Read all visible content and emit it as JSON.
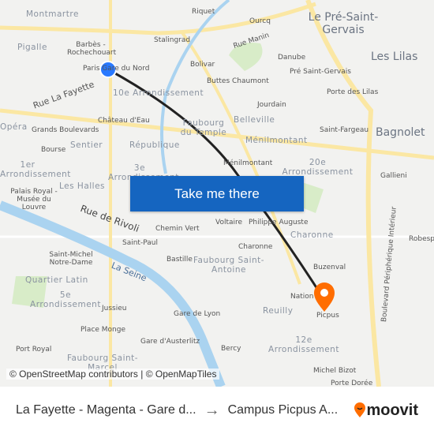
{
  "map": {
    "labels": [
      "Montmartre",
      "Pigalle",
      "Barbès - Rochechouart",
      "Paris Gare du Nord",
      "Stalingrad",
      "Riquet",
      "Ourcq",
      "Rue Manin",
      "Bolivar",
      "Buttes Chaumont",
      "Danube",
      "Pré Saint-Gervais",
      "Porte des Lilas",
      "Jourdain",
      "Belleville",
      "Ménilmontant",
      "Saint-Fargeau",
      "Rue La Fayette",
      "Château d'Eau",
      "Opéra",
      "Grands Boulevards",
      "Bourse",
      "Sentier",
      "République",
      "Ménilmontant",
      "Gallieni",
      "Palais Royal - Musée du Louvre",
      "Rue de Rivoli",
      "Chemin Vert",
      "Voltaire",
      "Philippe Auguste",
      "Saint-Paul",
      "Bastille",
      "Charonne",
      "Buzenval",
      "Saint-Michel Notre-Dame",
      "La Seine",
      "Jussieu",
      "Nation",
      "Picpus",
      "Reuilly",
      "Place Monge",
      "Gare de Lyon",
      "Gare d'Austerlitz",
      "Port Royal",
      "Bercy",
      "Michel Bizot",
      "Porte Dorée",
      "Boulevard Périphérique Intérieur",
      "Robespierre"
    ],
    "districts": [
      "10e Arrondissement",
      "Faubourg du Temple",
      "1er Arrondissement",
      "Les Halles",
      "3e Arrondissement",
      "20e Arrondissement",
      "Charonne",
      "Faubourg Saint-Antoine",
      "Quartier Latin",
      "5e Arrondissement",
      "12e Arrondissement",
      "Faubourg Saint-Marcel"
    ],
    "towns": [
      "Le Pré-Saint-Gervais",
      "Les Lilas",
      "Bagnolet"
    ],
    "origin_color": "#2979ff",
    "destination_color": "#ff6d00",
    "route_color": "#222222"
  },
  "cta": "Take me there",
  "attribution": "© OpenStreetMap contributors | © OpenMapTiles",
  "bar": {
    "from": "La Fayette - Magenta - Gare d...",
    "to": "Campus Picpus A...",
    "brand": "moovit",
    "arrow_icon": "arrow-right-icon"
  }
}
